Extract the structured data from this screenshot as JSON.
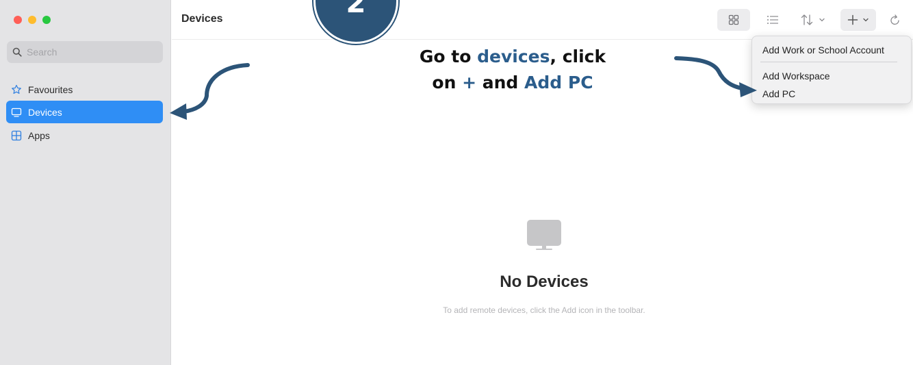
{
  "sidebar": {
    "search_placeholder": "Search",
    "items": [
      {
        "label": "Favourites",
        "icon": "star-icon"
      },
      {
        "label": "Devices",
        "icon": "monitor-icon",
        "active": true
      },
      {
        "label": "Apps",
        "icon": "apps-grid-icon"
      }
    ]
  },
  "toolbar": {
    "title": "Devices",
    "buttons": [
      "grid-view-icon",
      "list-view-icon",
      "sort-icon",
      "add-icon",
      "refresh-icon"
    ]
  },
  "add_menu": {
    "items": [
      "Add Work or School Account",
      "Add Workspace",
      "Add PC"
    ]
  },
  "empty_state": {
    "title": "No Devices",
    "subtitle": "To add remote devices, click the Add icon in the toolbar."
  },
  "annotation": {
    "step_number": "2",
    "line1_prefix": "Go to ",
    "line1_highlight": "devices",
    "line1_suffix": ", click",
    "line2_prefix": "on ",
    "line2_plus": "+",
    "line2_mid": " and ",
    "line2_highlight": "Add PC"
  },
  "colors": {
    "accent": "#2f8ef5",
    "annotation_blue": "#2c5478",
    "highlight_text": "#2b5d8c",
    "sidebar_bg": "#e4e4e6"
  }
}
